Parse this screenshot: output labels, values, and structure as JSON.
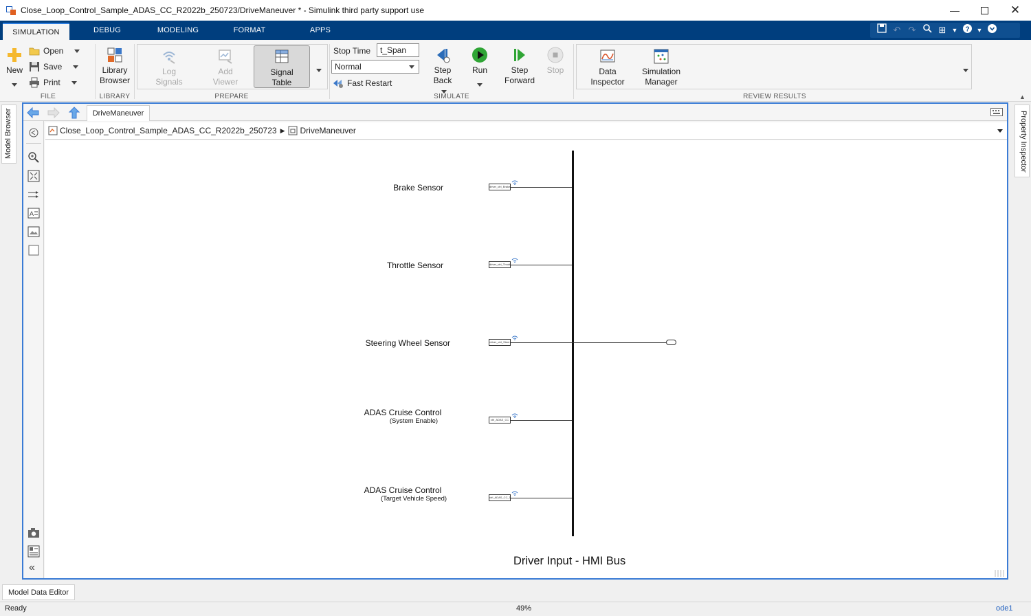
{
  "window": {
    "title": "Close_Loop_Control_Sample_ADAS_CC_R2022b_250723/DriveManeuver * - Simulink third party support use",
    "controls": [
      "minimize",
      "maximize",
      "close"
    ]
  },
  "ribbon_tabs": [
    {
      "label": "SIMULATION",
      "active": true
    },
    {
      "label": "DEBUG"
    },
    {
      "label": "MODELING"
    },
    {
      "label": "FORMAT"
    },
    {
      "label": "APPS"
    }
  ],
  "ribbon": {
    "file": {
      "label": "FILE",
      "new": "New",
      "open": "Open",
      "save": "Save",
      "print": "Print"
    },
    "library": {
      "label": "LIBRARY",
      "library_browser": [
        "Library",
        "Browser"
      ]
    },
    "prepare": {
      "label": "PREPARE",
      "log_signals": [
        "Log",
        "Signals"
      ],
      "add_viewer": [
        "Add",
        "Viewer"
      ],
      "signal_table": [
        "Signal",
        "Table"
      ]
    },
    "simulate": {
      "label": "SIMULATE",
      "stop_time_label": "Stop Time",
      "stop_time_value": "t_Span",
      "mode": "Normal",
      "fast_restart": "Fast Restart",
      "step_back": [
        "Step",
        "Back"
      ],
      "run": "Run",
      "step_forward": [
        "Step",
        "Forward"
      ],
      "stop": "Stop"
    },
    "review": {
      "label": "REVIEW RESULTS",
      "data_inspector": [
        "Data",
        "Inspector"
      ],
      "simulation_manager": [
        "Simulation",
        "Manager"
      ]
    }
  },
  "side_tabs": {
    "left": "Model Browser",
    "right": "Property Inspector"
  },
  "editor": {
    "tab": "DriveManeuver",
    "breadcrumb": [
      "Close_Loop_Control_Sample_ADAS_CC_R2022b_250723",
      "DriveManeuver"
    ]
  },
  "diagram": {
    "signals": [
      {
        "label": "Brake Sensor",
        "sub": "",
        "tag": "driver_ctrl_Brake"
      },
      {
        "label": "Throttle Sensor",
        "sub": "",
        "tag": "driver_ctrl_Throttle"
      },
      {
        "label": "Steering Wheel Sensor",
        "sub": "",
        "tag": "driver_ctrl_Steer"
      },
      {
        "label": "ADAS Cruise Control",
        "sub": "(System Enable)",
        "tag": "ctrl_ADAS_CC"
      },
      {
        "label": "ADAS Cruise Control",
        "sub": "(Target Vehicle Speed)",
        "tag": "ctrl_ADAS_CC_Tgt"
      }
    ],
    "bus_title": "Driver Input - HMI Bus"
  },
  "bottom_tab": "Model Data Editor",
  "status": {
    "state": "Ready",
    "zoom": "49%",
    "solver": "ode1"
  },
  "colors": {
    "ribbon_tab_bg": "#003e7e",
    "editor_border": "#3a7bd5",
    "run_green": "#2fa535"
  }
}
